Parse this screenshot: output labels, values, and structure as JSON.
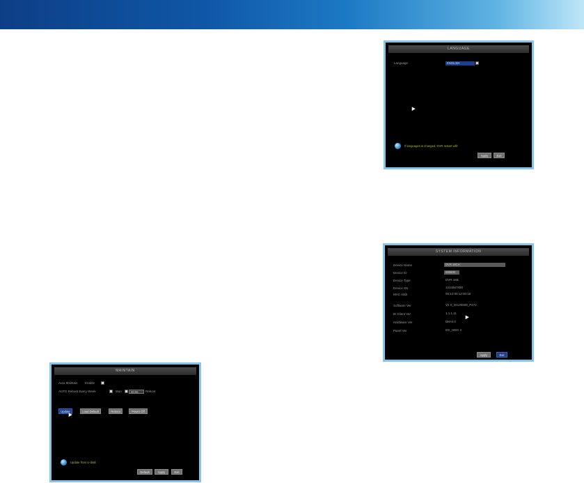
{
  "language_dialog": {
    "title": "LANGUAGE",
    "language_label": "Language",
    "language_value": "ENGLISH",
    "hint": "If languages is changed, DVR restart will!",
    "apply": "Apply",
    "exit": "Exit"
  },
  "sysinfo_dialog": {
    "title": "SYSTEM INFORMATION",
    "rows": [
      {
        "label": "Device Name",
        "value": "DVR 16CH"
      },
      {
        "label": "Device ID",
        "value": "000000"
      },
      {
        "label": "Device Type",
        "value": "DVR 16B"
      },
      {
        "label": "Device SN",
        "value": "1234567890"
      },
      {
        "label": "MAC Addr",
        "value": "00:12:00:12:00:18"
      },
      {
        "label": "Software Ver",
        "value": "V2.0_20130608_P472"
      },
      {
        "label": "IE Client Ver",
        "value": "1.1.1.11"
      },
      {
        "label": "Hardware Ver",
        "value": "DM-8.0"
      },
      {
        "label": "Panel Ver",
        "value": "DS_HWX 2"
      }
    ],
    "apply": "Apply",
    "exit": "Exit"
  },
  "maintain_dialog": {
    "title": "MAINTAIN",
    "auto_maintain_label": "Auto Maintain",
    "auto_maintain_value": "Enable",
    "period_label": "AUTO Reboot Every Week",
    "period_mid": "Mon",
    "time_value": "00:00",
    "period_suffix": "Reboot",
    "buttons": [
      "Update",
      "Load Default",
      "Reboot",
      "Power Off"
    ],
    "hint": "Update from U-disk!",
    "default": "Default",
    "apply": "Apply",
    "exit": "Exit"
  }
}
